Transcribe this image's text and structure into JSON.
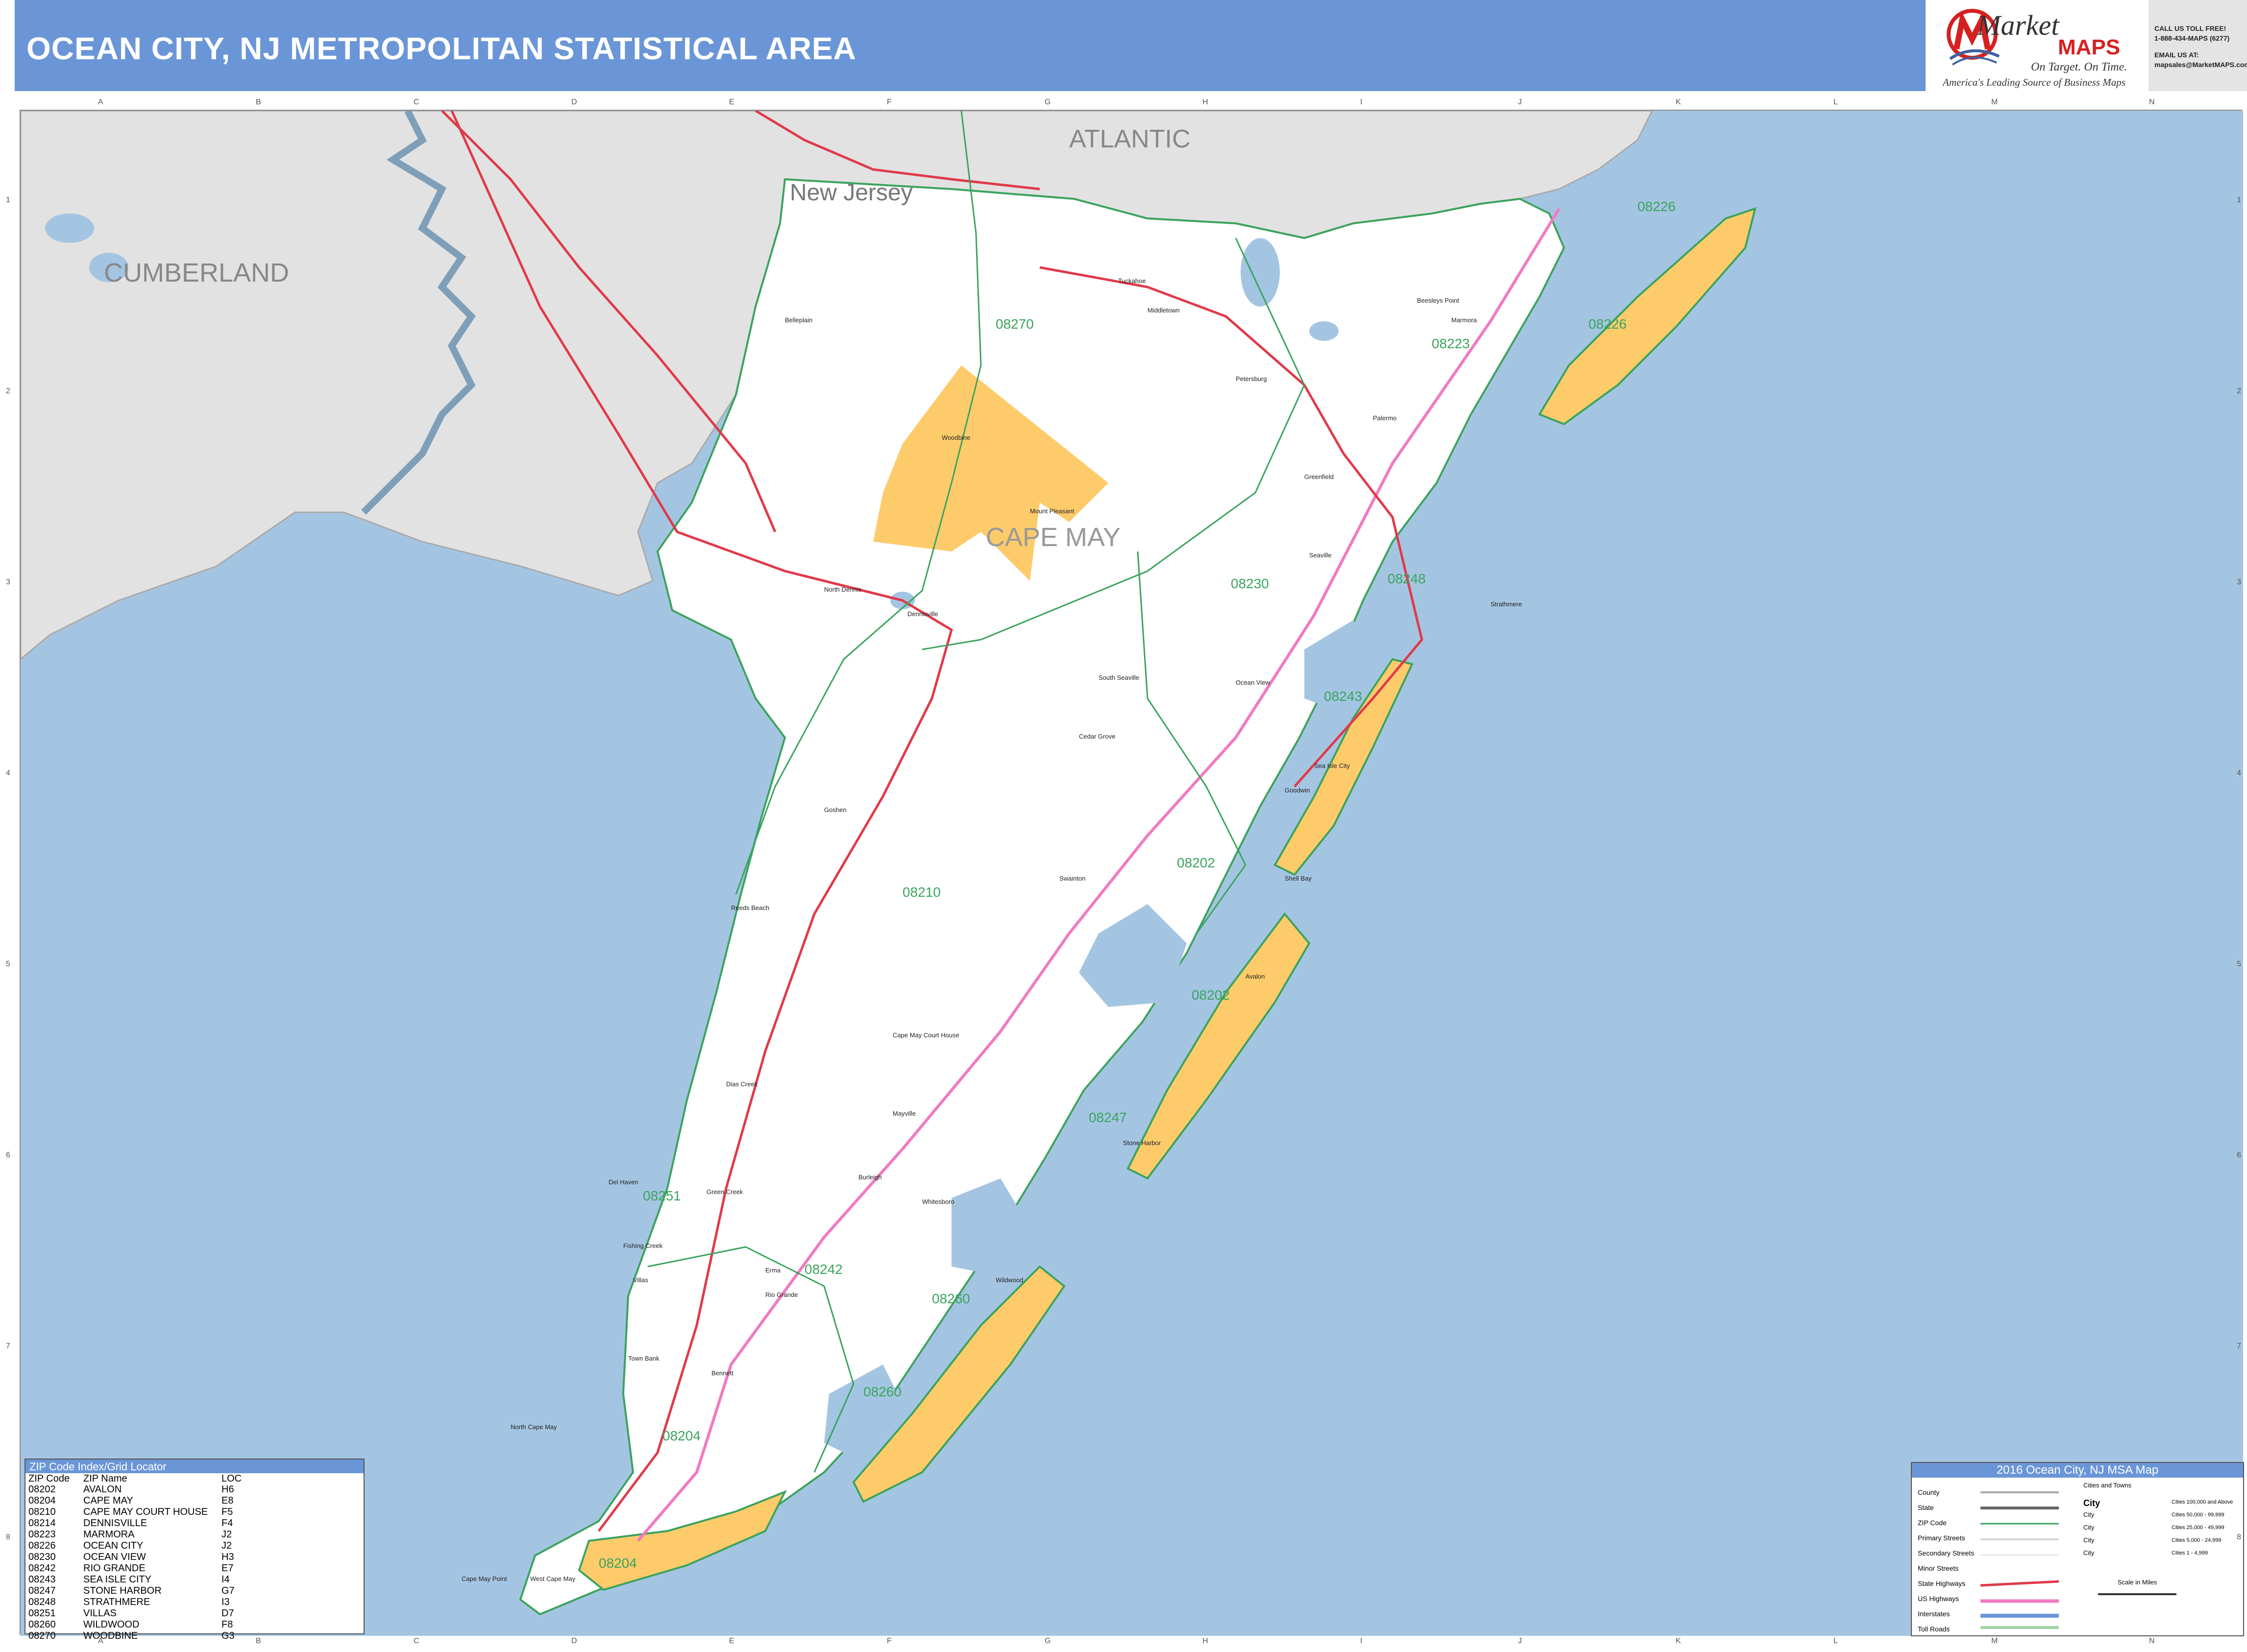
{
  "header": {
    "title": "OCEAN CITY, NJ METROPOLITAN STATISTICAL AREA"
  },
  "logo": {
    "word1": "Market",
    "word2": "MAPS",
    "slogan": "On Target. On Time.",
    "tagline": "America's Leading Source of Business Maps"
  },
  "contact": {
    "line1": "CALL US TOLL FREE!",
    "line2": "1-888-434-MAPS (6277)",
    "line3": "EMAIL US AT:",
    "line4": "mapsales@MarketMAPS.com"
  },
  "grid": {
    "letters": [
      "A",
      "B",
      "C",
      "D",
      "E",
      "F",
      "G",
      "H",
      "I",
      "J",
      "K",
      "L",
      "M",
      "N"
    ],
    "numbers": [
      "1",
      "2",
      "3",
      "4",
      "5",
      "6",
      "7",
      "8"
    ]
  },
  "map_labels": {
    "state": "New Jersey",
    "ocean": "ATLANTIC",
    "county_cumberland": "CUMBERLAND",
    "county_capemay": "CAPE MAY"
  },
  "zip_labels": [
    "08270",
    "08223",
    "08226",
    "08230",
    "08248",
    "08243",
    "08202",
    "08210",
    "08247",
    "08251",
    "08204",
    "08242",
    "08260",
    "08204",
    "08226",
    "08202",
    "08260"
  ],
  "town_labels": [
    "Tuckahoe",
    "Middletown",
    "Belleplain",
    "Woodbine",
    "Mount Pleasant",
    "Petersburg",
    "Marmora",
    "Palermo",
    "Greenfield",
    "Seaville",
    "Dennisville",
    "North Dennis",
    "South Seaville",
    "Ocean View",
    "Cedar Grove",
    "Goshen",
    "Swainton",
    "Sea Isle City",
    "Reeds Beach",
    "Cape May Court House",
    "Mayville",
    "Burleigh",
    "Whitesboro",
    "Del Haven",
    "Green Creek",
    "Villas",
    "Rio Grande",
    "Erma",
    "Bennett",
    "West Cape May",
    "Cape May Point",
    "Stone Harbor",
    "Avalon",
    "Wildwood",
    "Strathmere",
    "Beesleys Point",
    "Goodwin",
    "Shell Bay",
    "North Cape May",
    "Dias Creek",
    "Fishing Creek",
    "Town Bank"
  ],
  "zip_index": {
    "title": "ZIP Code Index/Grid Locator",
    "columns": [
      "ZIP Code",
      "ZIP Name",
      "LOC"
    ],
    "rows": [
      [
        "08202",
        "AVALON",
        "H6"
      ],
      [
        "08204",
        "CAPE MAY",
        "E8"
      ],
      [
        "08210",
        "CAPE MAY COURT HOUSE",
        "F5"
      ],
      [
        "08214",
        "DENNISVILLE",
        "F4"
      ],
      [
        "08223",
        "MARMORA",
        "J2"
      ],
      [
        "08226",
        "OCEAN CITY",
        "J2"
      ],
      [
        "08230",
        "OCEAN VIEW",
        "H3"
      ],
      [
        "08242",
        "RIO GRANDE",
        "E7"
      ],
      [
        "08243",
        "SEA ISLE CITY",
        "I4"
      ],
      [
        "08247",
        "STONE HARBOR",
        "G7"
      ],
      [
        "08248",
        "STRATHMERE",
        "I3"
      ],
      [
        "08251",
        "VILLAS",
        "D7"
      ],
      [
        "08260",
        "WILDWOOD",
        "F8"
      ],
      [
        "08270",
        "WOODBINE",
        "G3"
      ]
    ]
  },
  "legend": {
    "title": "2016 Ocean City, NJ MSA Map",
    "cities_heading": "Cities and Towns",
    "rows": [
      "County",
      "State",
      "ZIP Code",
      "Primary Streets",
      "Secondary Streets",
      "Minor Streets",
      "State Highways",
      "US Highways",
      "Interstates",
      "Toll Roads"
    ],
    "city_sizes": [
      [
        "City",
        "Cities 100,000 and Above"
      ],
      [
        "City",
        "Cities 50,000 - 99,999"
      ],
      [
        "City",
        "Cities 25,000 - 49,999"
      ],
      [
        "City",
        "Cities 5,000 - 24,999"
      ],
      [
        "City",
        "Cities 1 - 4,999"
      ]
    ],
    "scale": "Scale in Miles",
    "colors": {
      "water": "#a4c5e2",
      "land": "#ffffff",
      "neighbor_land": "#e2e2e2",
      "city_fill": "#fecb6b",
      "zip_line": "#3ba35d",
      "state_highway": "#e03a4a",
      "us_highway": "#f07bc0",
      "header_blue": "#6a96d7"
    }
  }
}
